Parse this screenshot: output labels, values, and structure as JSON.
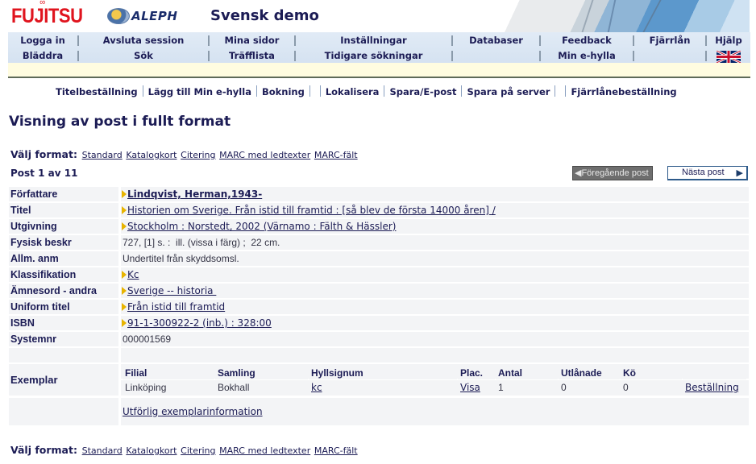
{
  "header": {
    "brand": "FUJITSU",
    "brand_mark": "∞",
    "product": "ALEPH",
    "site_title": "Svensk demo"
  },
  "nav": {
    "row1": [
      "Logga in",
      "Avsluta session",
      "Mina sidor",
      "Inställningar",
      "Databaser",
      "Feedback",
      "Fjärrlån",
      "Hjälp"
    ],
    "row2": [
      "Bläddra",
      "Sök",
      "Träfflista",
      "Tidigare sökningar",
      "",
      "Min e-hylla",
      "",
      ""
    ],
    "language_flag": "uk-flag-icon"
  },
  "actions": [
    "Titelbeställning",
    "Lägg till Min e-hylla",
    "Bokning",
    "",
    "Lokalisera",
    "Spara/E-post",
    "Spara på server",
    "",
    "Fjärrlånebeställning"
  ],
  "page_title": "Visning av post i fullt format",
  "format_select": {
    "label": "Välj format:",
    "options": [
      "Standard",
      "Katalogkort",
      "Citering",
      "MARC med ledtexter",
      "MARC-fält"
    ]
  },
  "post_count": "Post 1 av 11",
  "pager": {
    "prev_label": "◀Föregående post",
    "next_label": "Nästa post",
    "next_arrow": "▶"
  },
  "record": [
    {
      "label": "Författare",
      "value": "Lindqvist, Herman,1943-",
      "link": true,
      "bold": true
    },
    {
      "label": "Titel",
      "value": "Historien om Sverige. Från istid till framtid : [så blev de första 14000 åren] /",
      "link": true
    },
    {
      "label": "Utgivning",
      "value": "Stockholm : Norstedt, 2002 (Värnamo : Fälth & Hässler)",
      "link": true
    },
    {
      "label": "Fysisk beskr",
      "value": "727, [1] s. :  ill. (vissa i färg) ;  22 cm.",
      "link": false
    },
    {
      "label": "Allm. anm",
      "value": "Undertitel från skyddsomsl.",
      "link": false
    },
    {
      "label": "Klassifikation",
      "value": "Kc",
      "link": true
    },
    {
      "label": "Ämnesord - andra",
      "value": "Sverige -- historia ",
      "link": true
    },
    {
      "label": "Uniform titel",
      "value": "Från istid till framtid",
      "link": true
    },
    {
      "label": "ISBN",
      "value": "91-1-300922-2 (inb.) : 328:00",
      "link": true
    },
    {
      "label": "Systemnr",
      "value": "000001569",
      "link": false
    },
    {
      "label": "",
      "value": "",
      "link": false
    }
  ],
  "holdings": {
    "label": "Exemplar",
    "columns": [
      "Filial",
      "Samling",
      "Hyllsignum",
      "Plac.",
      "Antal",
      "Utlånade",
      "Kö",
      ""
    ],
    "rows": [
      {
        "filial": "Linköping",
        "samling": "Bokhall",
        "hyllsignum": "kc",
        "plac": "Visa",
        "antal": "1",
        "utlanade": "0",
        "ko": "0",
        "action": "Beställning"
      }
    ],
    "more_link": "Utförlig exemplarinformation"
  }
}
